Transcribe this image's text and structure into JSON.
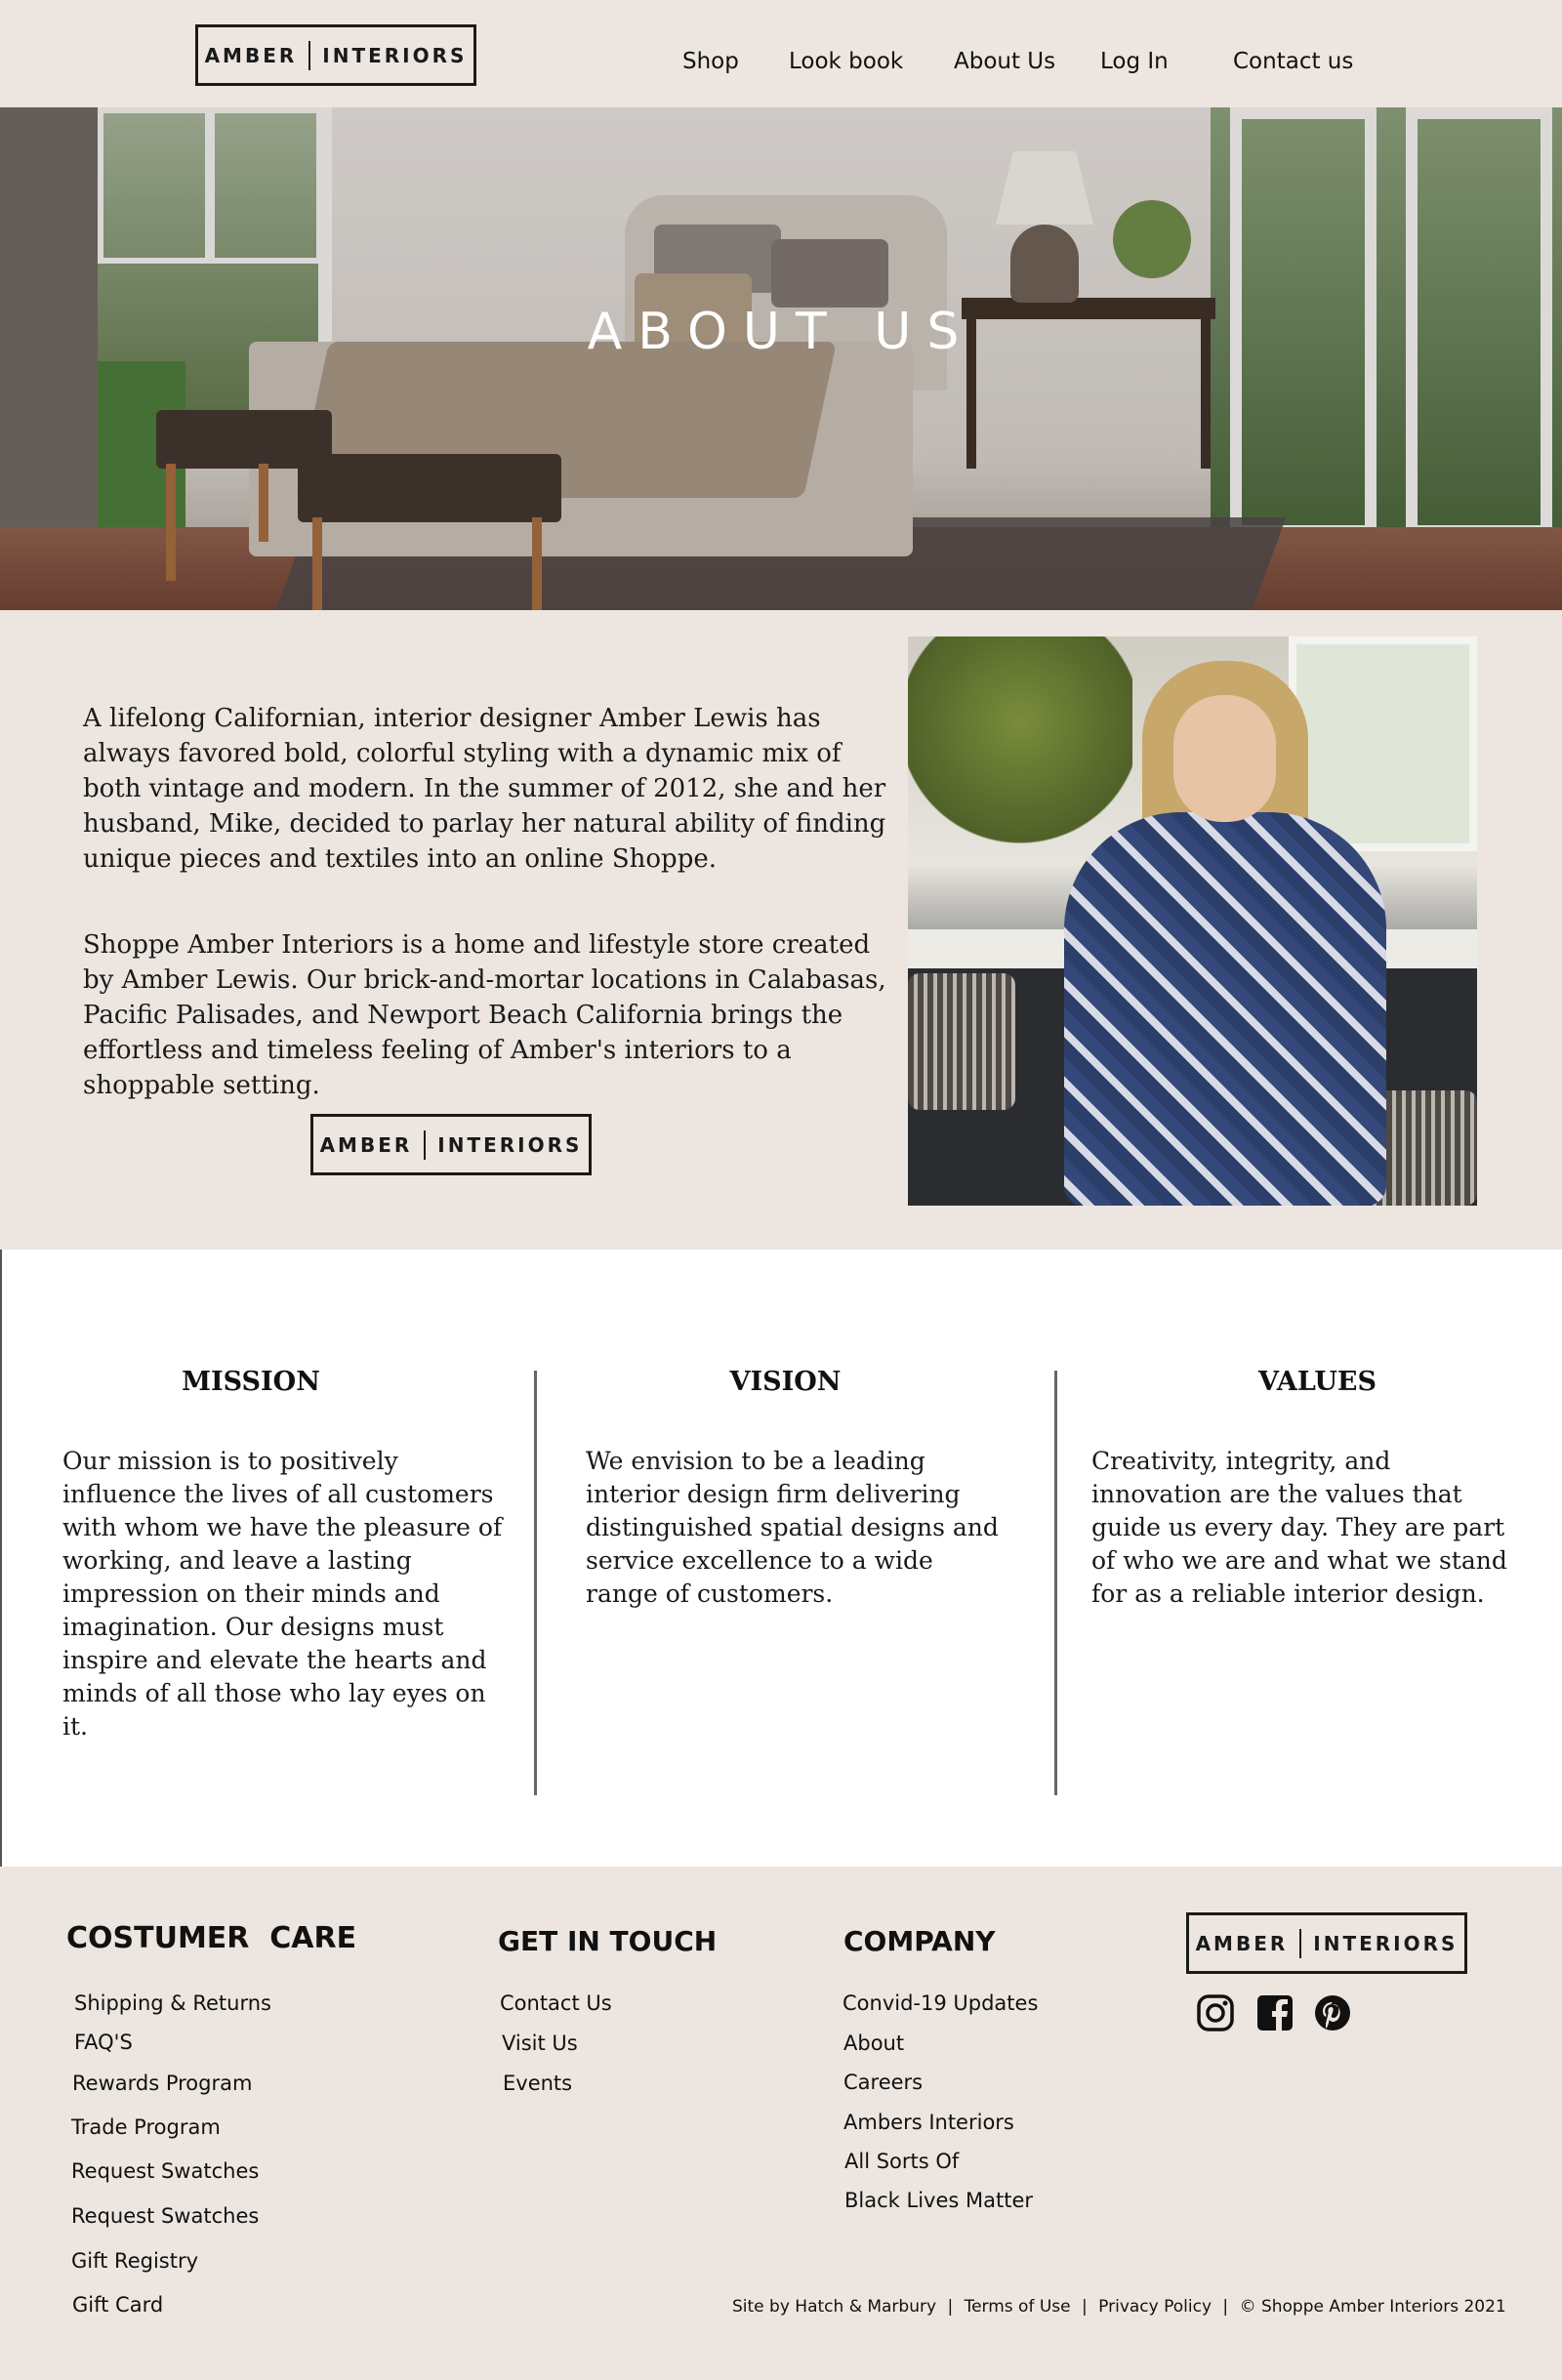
{
  "brand": {
    "logo_left": "AMBER",
    "logo_right": "INTERIORS"
  },
  "nav": {
    "items": [
      "Shop",
      "Look book",
      "About Us",
      "Log In",
      "Contact us"
    ]
  },
  "hero": {
    "title": "ABOUT US"
  },
  "about": {
    "paragraph1": "A lifelong Californian, interior designer Amber Lewis has always favored bold, colorful styling with a dynamic mix of both vintage and modern. In the summer of 2012, she and her husband, Mike, decided to parlay her natural ability of finding unique pieces and textiles into an online Shoppe.",
    "paragraph2": "Shoppe Amber Interiors is a home and lifestyle store created by Amber Lewis. Our brick-and-mortar locations in Calabasas, Pacific Palisades, and Newport Beach California brings the effortless and timeless feeling of Amber's interiors to a shoppable setting."
  },
  "mvv": {
    "mission": {
      "title": "MISSION",
      "text": "Our mission is to positively influence the lives of all customers with whom we have the pleasure of working, and leave a lasting impression on their minds and imagination. Our designs must inspire and elevate the hearts and minds of all those who lay eyes on it."
    },
    "vision": {
      "title": "VISION",
      "text": "We envision to be a leading interior design firm delivering distinguished spatial designs and service excellence to a wide range of customers."
    },
    "values": {
      "title": "VALUES",
      "text": "Creativity, integrity, and innovation are the values that guide us every day. They are part of who we are and what we stand for as a reliable interior design."
    }
  },
  "footer": {
    "care": {
      "heading": "COSTUMER  CARE",
      "links": [
        "Shipping & Returns",
        "FAQ'S",
        "Rewards Program",
        "Trade Program",
        "Request Swatches",
        "Request Swatches",
        "Gift Registry",
        "Gift Card"
      ]
    },
    "touch": {
      "heading": "GET IN TOUCH",
      "links": [
        "Contact Us",
        "Visit Us",
        "Events"
      ]
    },
    "company": {
      "heading": "COMPANY",
      "links": [
        "Convid-19 Updates",
        "About",
        "Careers",
        "Ambers Interiors",
        "All Sorts Of",
        "Black Lives Matter"
      ]
    },
    "social": [
      "instagram-icon",
      "facebook-icon",
      "pinterest-icon"
    ],
    "credits": {
      "site_by": "Site by Hatch & Marbury",
      "terms": "Terms of Use",
      "privacy": "Privacy Policy",
      "copyright": "© Shoppe Amber Interiors 2021",
      "separator": "|"
    }
  }
}
